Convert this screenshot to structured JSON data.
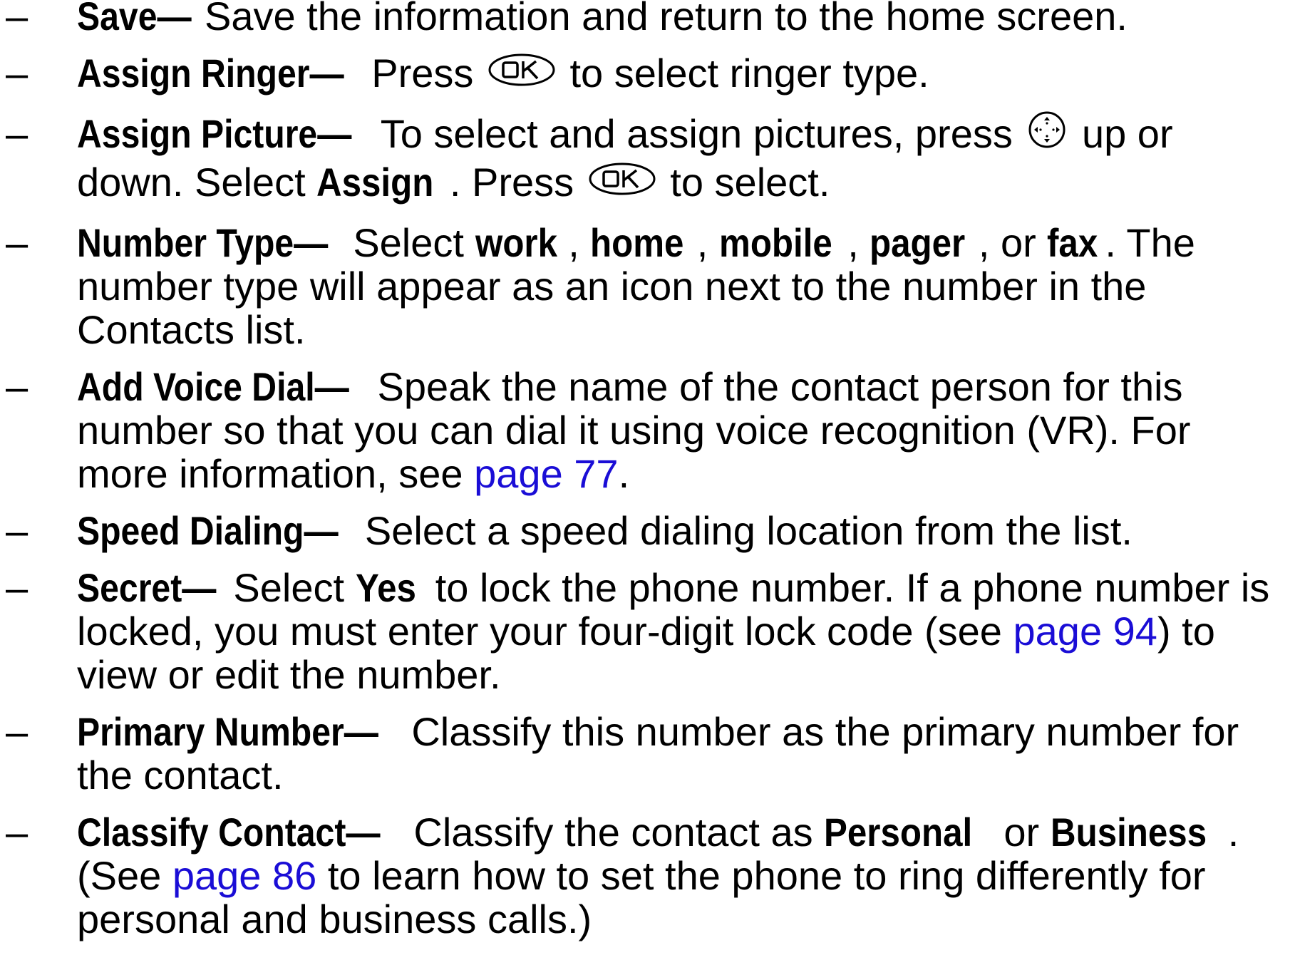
{
  "dash": "–",
  "items": [
    {
      "term": "Save",
      "sep": "—",
      "text": "Save the information and return to the home screen."
    },
    {
      "term": "Assign Ringer",
      "sep": "—",
      "pre": "Press ",
      "icon": "ok-key-icon",
      "post": " to select ringer type."
    },
    {
      "term": "Assign Picture",
      "sep": "—",
      "pre": "To select and assign pictures, press ",
      "icon1": "navigation-key-icon",
      "mid1": " up or down. Select ",
      "bold1": "Assign",
      "mid2": ". Press ",
      "icon2": "ok-key-icon",
      "post": " to select."
    },
    {
      "term": "Number Type",
      "sep": "—",
      "pre": "Select ",
      "opt1": "work",
      "c1": ", ",
      "opt2": "home",
      "c2": ", ",
      "opt3": "mobile",
      "c3": ", ",
      "opt4": "pager",
      "c4": ", or ",
      "opt5": "fax",
      "post": ". The number type will appear as an icon next to the number in the Contacts list."
    },
    {
      "term": "Add Voice Dial",
      "sep": "—",
      "pre": "Speak the name of the contact person for this number so that you can dial it using voice recognition (VR). For more information, see ",
      "link": "page 77",
      "post": "."
    },
    {
      "term": "Speed Dialing",
      "sep": "—",
      "text": "Select a speed dialing location from the list."
    },
    {
      "term": "Secret",
      "sep": "—",
      "pre": "Select ",
      "bold1": "Yes",
      "mid": " to lock the phone number. If a phone number is locked, you must enter your four-digit lock code (see ",
      "link": "page 94",
      "post": ") to view or edit the number."
    },
    {
      "term": "Primary Number",
      "sep": "—",
      "text": "Classify this number as the primary number for the contact."
    },
    {
      "term": "Classify Contact",
      "sep": "—",
      "pre": "Classify the contact as ",
      "bold1": "Personal",
      "mid1": " or ",
      "bold2": "Business",
      "mid2": ". (See ",
      "link": "page 86",
      "post": " to learn how to set the phone to ring differently for personal and business calls.)"
    }
  ],
  "colors": {
    "text": "#000000",
    "link": "#1a0dd6",
    "background": "#ffffff"
  }
}
